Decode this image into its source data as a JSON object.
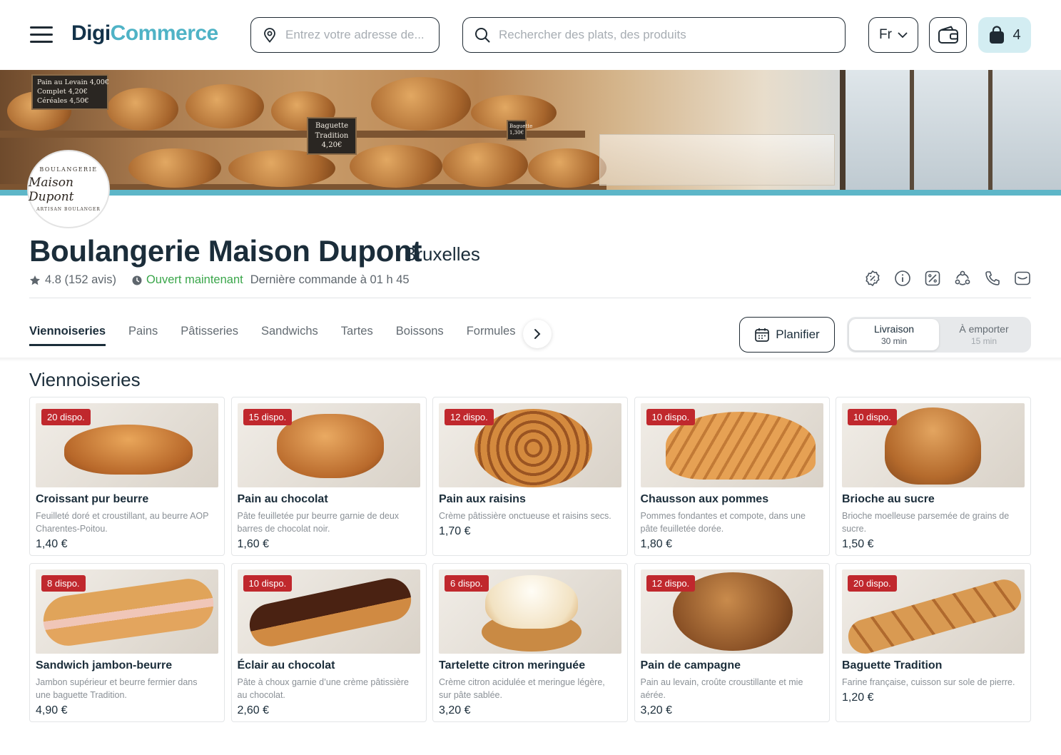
{
  "header": {
    "logo_part1": "Digi",
    "logo_part2": "Commerce",
    "address_placeholder": "Entrez votre adresse de...",
    "search_placeholder": "Rechercher des plats, des produits",
    "language": "Fr",
    "cart_count": "4",
    "icons": [
      "menu-icon",
      "location-pin-icon",
      "search-icon",
      "chevron-down-icon",
      "wallet-icon",
      "shopping-bag-icon"
    ]
  },
  "banner": {
    "signs": [
      {
        "text": "Pain au Levain 4,00€\nComplet 4,20€\nCéréales 4,50€"
      },
      {
        "text": "Baguette\nTradition\n4,20€"
      },
      {
        "text": "Baguette\n1,30€"
      }
    ],
    "badge": {
      "top": "BOULANGERIE",
      "name": "Maison Dupont",
      "bottom": "ARTISAN BOULANGER"
    }
  },
  "shop": {
    "name": "Boulangerie Maison Dupont",
    "city": "Bruxelles",
    "rating": "4.8 (152 avis)",
    "status": "Ouvert maintenant",
    "last_order": "Dernière commande à 01 h 45",
    "action_icons": [
      "discount-badge-icon",
      "info-icon",
      "offer-tag-icon",
      "share-icon",
      "phone-icon",
      "message-icon"
    ]
  },
  "tabs": {
    "items": [
      "Viennoiseries",
      "Pains",
      "Pâtisseries",
      "Sandwichs",
      "Tartes",
      "Boissons",
      "Formules"
    ],
    "active": "Viennoiseries",
    "plan_label": "Planifier",
    "delivery_label": "Livraison",
    "delivery_time": "30 min",
    "pickup_label": "À emporter",
    "pickup_time": "15 min"
  },
  "section_title": "Viennoiseries",
  "products": [
    {
      "stock": "20 dispo.",
      "name": "Croissant pur beurre",
      "desc": "Feuilleté doré et croustillant, au beurre AOP Charentes-Poitou.",
      "price": "1,40 €"
    },
    {
      "stock": "15 dispo.",
      "name": "Pain au chocolat",
      "desc": "Pâte feuilletée pur beurre garnie de deux barres de chocolat noir.",
      "price": "1,60 €"
    },
    {
      "stock": "12 dispo.",
      "name": "Pain aux raisins",
      "desc": "Crème pâtissière onctueuse et raisins secs.",
      "price": "1,70 €"
    },
    {
      "stock": "10 dispo.",
      "name": "Chausson aux pommes",
      "desc": "Pommes fondantes et compote, dans une pâte feuilletée dorée.",
      "price": "1,80 €"
    },
    {
      "stock": "10 dispo.",
      "name": "Brioche au sucre",
      "desc": "Brioche moelleuse parsemée de grains de sucre.",
      "price": "1,50 €"
    },
    {
      "stock": "8 dispo.",
      "name": "Sandwich jambon-beurre",
      "desc": "Jambon supérieur et beurre fermier dans une baguette Tradition.",
      "price": "4,90 €"
    },
    {
      "stock": "10 dispo.",
      "name": "Éclair au chocolat",
      "desc": "Pâte à choux garnie d’une crème pâtissière au chocolat.",
      "price": "2,60 €"
    },
    {
      "stock": "6 dispo.",
      "name": "Tartelette citron meringuée",
      "desc": "Crème citron acidulée et meringue légère, sur pâte sablée.",
      "price": "3,20 €"
    },
    {
      "stock": "12 dispo.",
      "name": "Pain de campagne",
      "desc": "Pain au levain, croûte croustillante et mie aérée.",
      "price": "3,20 €"
    },
    {
      "stock": "20 dispo.",
      "name": "Baguette Tradition",
      "desc": "Farine française, cuisson sur sole de pierre.",
      "price": "1,20 €"
    }
  ],
  "colors": {
    "brand_dark": "#14334a",
    "brand_teal": "#4fb3c6",
    "stock_badge": "#c0282d",
    "open_green": "#3aa64a",
    "cart_bg": "#d3edf2"
  }
}
